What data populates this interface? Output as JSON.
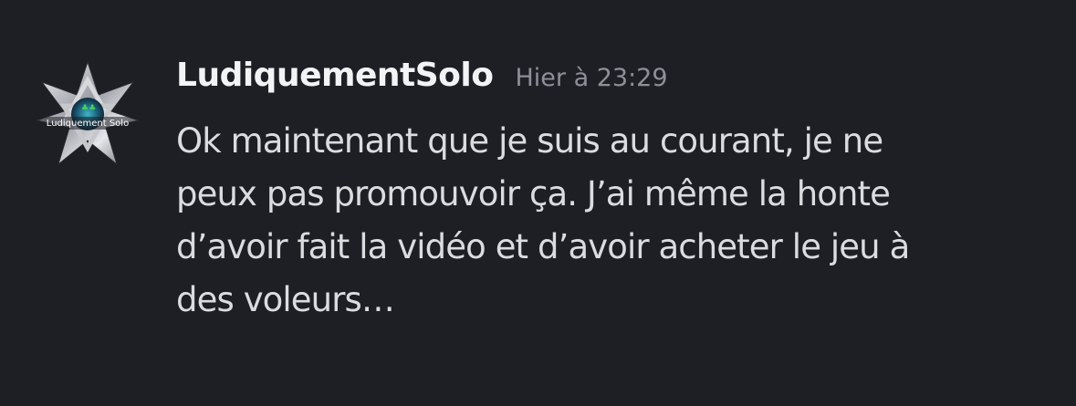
{
  "message": {
    "author": "LudiquementSolo",
    "timestamp": "Hier à 23:29",
    "avatar_text": "Ludiquement Solo",
    "content_lines": [
      "Ok maintenant que je suis au courant, je ne",
      "peux pas promouvoir ça. J’ai même la honte",
      "d’avoir fait la vidéo et d’avoir acheter le jeu à",
      "des voleurs…"
    ]
  },
  "colors": {
    "background": "#1e1f24",
    "username": "#f2f3f5",
    "timestamp": "#8e9099",
    "text": "#dadce0"
  }
}
